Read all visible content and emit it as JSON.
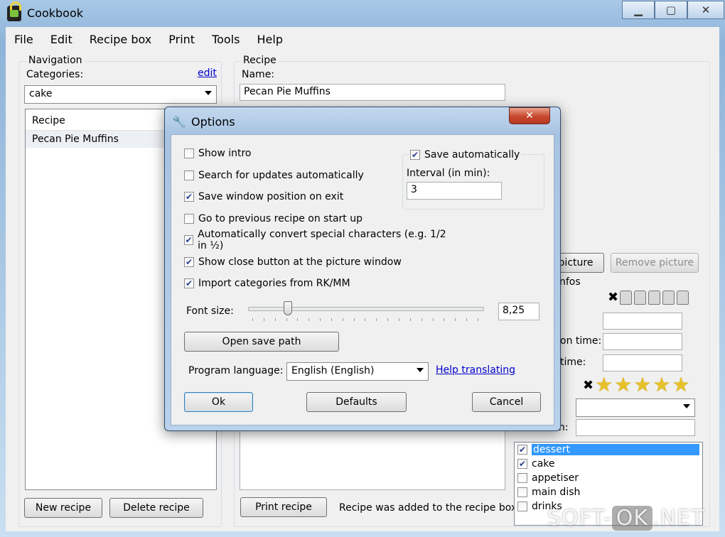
{
  "window": {
    "title": "Cookbook"
  },
  "menu": [
    "File",
    "Edit",
    "Recipe box",
    "Print",
    "Tools",
    "Help"
  ],
  "navigation": {
    "group_label": "Navigation",
    "categories_label": "Categories:",
    "edit_link": "edit",
    "category_value": "cake",
    "list_header": "Recipe",
    "recipes": [
      "Pecan Pie Muffins"
    ],
    "new_button": "New recipe",
    "delete_button": "Delete recipe"
  },
  "recipe": {
    "group_label": "Recipe",
    "name_label": "Name:",
    "name_value": "Pecan Pie Muffins",
    "picture_button": "picture",
    "remove_picture_button": "Remove picture",
    "infos_label": "nfos",
    "prep_time_label": "on time:",
    "cook_time_label": "time:",
    "label_fragment": "n:",
    "difficulty_x": "✖",
    "rating_x": "✖",
    "rating_stars": 5,
    "difficulty_level": 0,
    "categories": [
      {
        "name": "dessert",
        "checked": true,
        "selected": true
      },
      {
        "name": "cake",
        "checked": true,
        "selected": false
      },
      {
        "name": "appetiser",
        "checked": false,
        "selected": false
      },
      {
        "name": "main dish",
        "checked": false,
        "selected": false
      },
      {
        "name": "drinks",
        "checked": false,
        "selected": false
      }
    ],
    "print_button": "Print recipe",
    "status_text": "Recipe was added to the recipe box!"
  },
  "options": {
    "title": "Options",
    "checkboxes": [
      {
        "label": "Show intro",
        "checked": false
      },
      {
        "label": "Search for updates automatically",
        "checked": false
      },
      {
        "label": "Save window position on exit",
        "checked": true
      },
      {
        "label": "Go to previous recipe on start up",
        "checked": false
      },
      {
        "label": "Automatically convert special characters (e.g. 1/2 in ½)",
        "checked": true
      },
      {
        "label": "Show close button at the picture window",
        "checked": true
      },
      {
        "label": "Import categories from RK/MM",
        "checked": true
      }
    ],
    "save_auto_label": "Save automatically",
    "save_auto_checked": true,
    "interval_label": "Interval (in min):",
    "interval_value": "3",
    "font_size_label": "Font size:",
    "font_size_value": "8,25",
    "open_save_path": "Open save path",
    "language_label": "Program language:",
    "language_value": "English (English)",
    "help_translating": "Help translating",
    "ok": "Ok",
    "defaults": "Defaults",
    "cancel": "Cancel"
  },
  "watermark": {
    "left": "SOFT-",
    "box": "OK",
    "right": ".NET"
  },
  "colors": {
    "selection": "#3399ff",
    "link": "#0000cc",
    "star": "#e6c12a"
  },
  "icons": [
    "cookbook-app-icon",
    "minimize-icon",
    "maximize-icon",
    "close-icon",
    "wrench-icon",
    "chevron-down-icon",
    "star-icon",
    "shirt-icon",
    "check-icon"
  ]
}
